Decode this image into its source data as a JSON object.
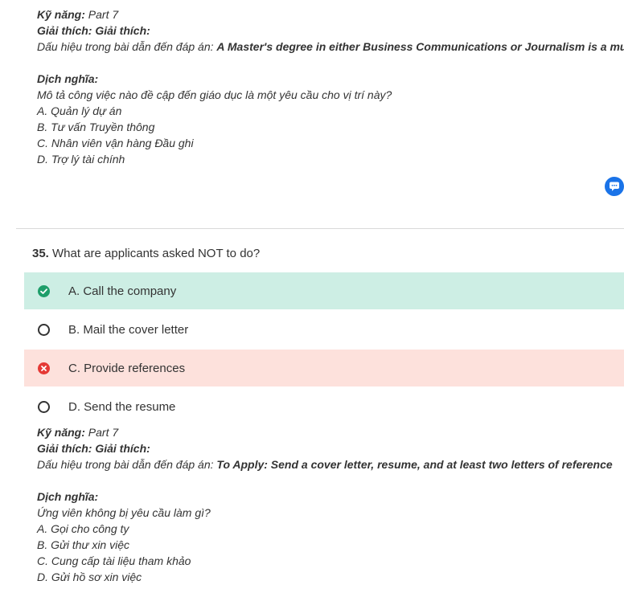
{
  "top_explanation": {
    "skill_label": "Kỹ năng:",
    "skill_value": " Part 7",
    "explain_label": "Giải thích: Giải thích:",
    "evidence_label": "Dấu hiệu trong bài dẫn đến đáp án: ",
    "evidence_value": "A Master's degree in either Business Communications or Journalism is a must",
    "translation_label": "Dịch nghĩa:",
    "translation_question": "Mô tả công việc nào đề cập đến giáo dục là một yêu cầu cho vị trí này?",
    "translation_options": [
      "A. Quản lý dự án",
      "B. Tư vấn Truyền thông",
      "C. Nhân viên vận hàng Đầu ghi",
      "D. Trợ lý tài chính"
    ]
  },
  "question": {
    "number": "35.",
    "text": " What are applicants asked NOT to do?",
    "options": [
      {
        "label": "A. Call the company",
        "state": "correct"
      },
      {
        "label": "B. Mail the cover letter",
        "state": "none"
      },
      {
        "label": "C. Provide references",
        "state": "wrong"
      },
      {
        "label": "D. Send the resume",
        "state": "none"
      }
    ]
  },
  "bottom_explanation": {
    "skill_label": "Kỹ năng:",
    "skill_value": " Part 7",
    "explain_label": "Giải thích: Giải thích:",
    "evidence_label": "Dấu hiệu trong bài dẫn đến đáp án: ",
    "evidence_value": "To Apply: Send a cover letter, resume, and at least two letters of reference",
    "translation_label": "Dịch nghĩa:",
    "translation_question": "Ứng viên không bị yêu cầu làm gì?",
    "translation_options": [
      "A. Gọi cho công ty",
      "B. Gửi thư xin việc",
      "C. Cung cấp tài liệu tham khảo",
      "D. Gửi hồ sơ xin việc"
    ]
  },
  "colors": {
    "correct_bg": "#cdeee4",
    "wrong_bg": "#fde1dc",
    "correct_icon": "#1e9e6a",
    "wrong_icon": "#e53935",
    "chat_button": "#1a73e8"
  },
  "icons": {
    "chat": "chat-bubble-icon",
    "correct": "check-circle-icon",
    "wrong": "x-circle-icon",
    "unselected": "radio-empty-icon"
  }
}
